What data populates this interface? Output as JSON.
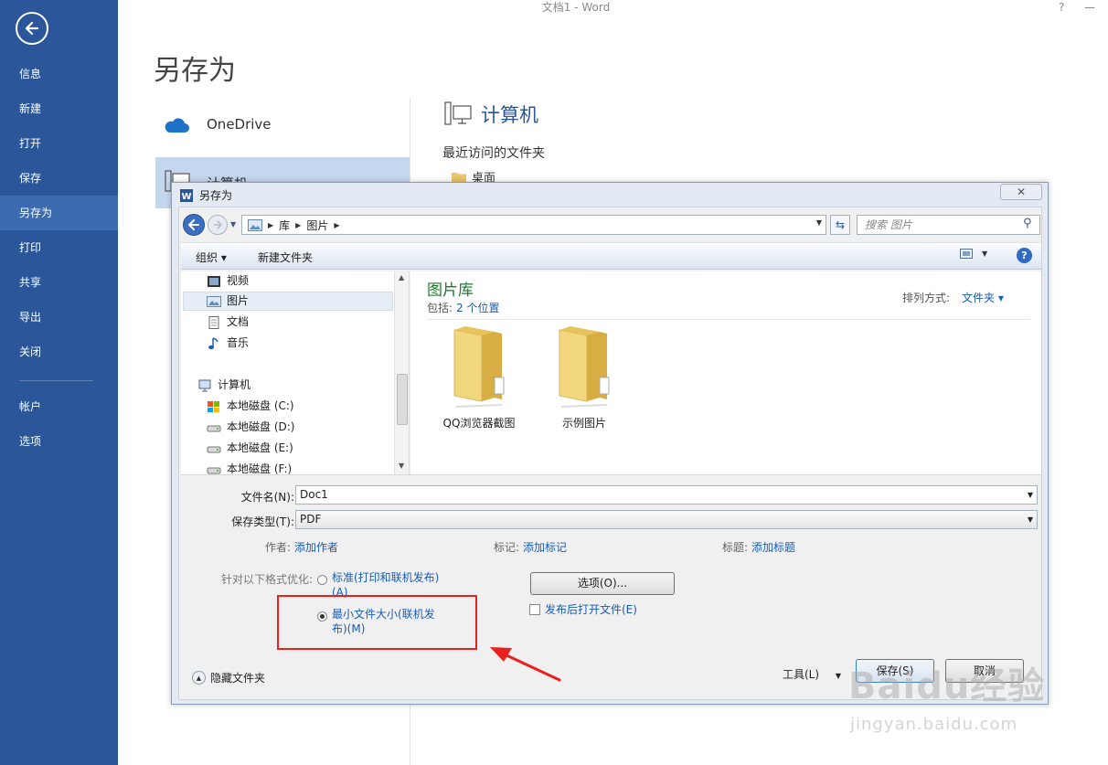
{
  "window": {
    "title": "文档1 - Word",
    "help_glyph": "?"
  },
  "sidebar": {
    "items": [
      {
        "label": "信息"
      },
      {
        "label": "新建"
      },
      {
        "label": "打开"
      },
      {
        "label": "保存"
      },
      {
        "label": "另存为",
        "active": true
      },
      {
        "label": "打印"
      },
      {
        "label": "共享"
      },
      {
        "label": "导出"
      },
      {
        "label": "关闭"
      },
      {
        "label": "帐户"
      },
      {
        "label": "选项"
      }
    ]
  },
  "backstage": {
    "heading": "另存为",
    "places": [
      {
        "label": "OneDrive",
        "icon": "cloud-icon"
      },
      {
        "label": "计算机",
        "icon": "computer-icon",
        "selected": true
      }
    ],
    "computer_heading": "计算机",
    "recent_label": "最近访问的文件夹",
    "recent_folders": [
      "桌面"
    ]
  },
  "dialog": {
    "title": "另存为",
    "close_glyph": "✕",
    "address": {
      "crumbs": [
        "库",
        "图片"
      ],
      "search_placeholder": "搜索 图片"
    },
    "toolbar": {
      "organize": "组织 ▾",
      "new_folder": "新建文件夹",
      "help": "?"
    },
    "nav_pane": {
      "items": [
        {
          "label": "视频",
          "icon": "video-icon"
        },
        {
          "label": "图片",
          "icon": "picture-icon",
          "selected": true
        },
        {
          "label": "文档",
          "icon": "document-icon"
        },
        {
          "label": "音乐",
          "icon": "music-icon"
        },
        {
          "label": "计算机",
          "icon": "computer-icon"
        },
        {
          "label": "本地磁盘 (C:)",
          "icon": "drive-c-icon"
        },
        {
          "label": "本地磁盘 (D:)",
          "icon": "drive-icon"
        },
        {
          "label": "本地磁盘 (E:)",
          "icon": "drive-icon"
        },
        {
          "label": "本地磁盘 (F:)",
          "icon": "drive-icon"
        }
      ]
    },
    "content": {
      "library_title": "图片库",
      "include_label": "包括:",
      "include_link": "2 个位置",
      "sort_label": "排列方式:",
      "sort_value": "文件夹 ▾",
      "folders": [
        "QQ浏览器截图",
        "示例图片"
      ]
    },
    "form": {
      "filename_label": "文件名(N):",
      "filename_value": "Doc1",
      "type_label": "保存类型(T):",
      "type_value": "PDF",
      "author_label": "作者:",
      "author_link": "添加作者",
      "tags_label": "标记:",
      "tags_link": "添加标记",
      "title_label": "标题:",
      "title_link": "添加标题",
      "optimize_label": "针对以下格式优化:",
      "opt_standard_1": "标准(打印和联机发布)",
      "opt_standard_2": "(A)",
      "opt_min_1": "最小文件大小(联机发",
      "opt_min_2": "布)(M)",
      "options_button": "选项(O)...",
      "open_after": "发布后打开文件(E)"
    },
    "footer": {
      "hide_folders": "隐藏文件夹",
      "tools": "工具(L)",
      "save": "保存(S)",
      "cancel": "取消"
    }
  },
  "annotation_color": "#e8211f",
  "accent_color": "#2b579a",
  "watermark": {
    "brand": "Baidu经验",
    "url": "jingyan.baidu.com"
  }
}
